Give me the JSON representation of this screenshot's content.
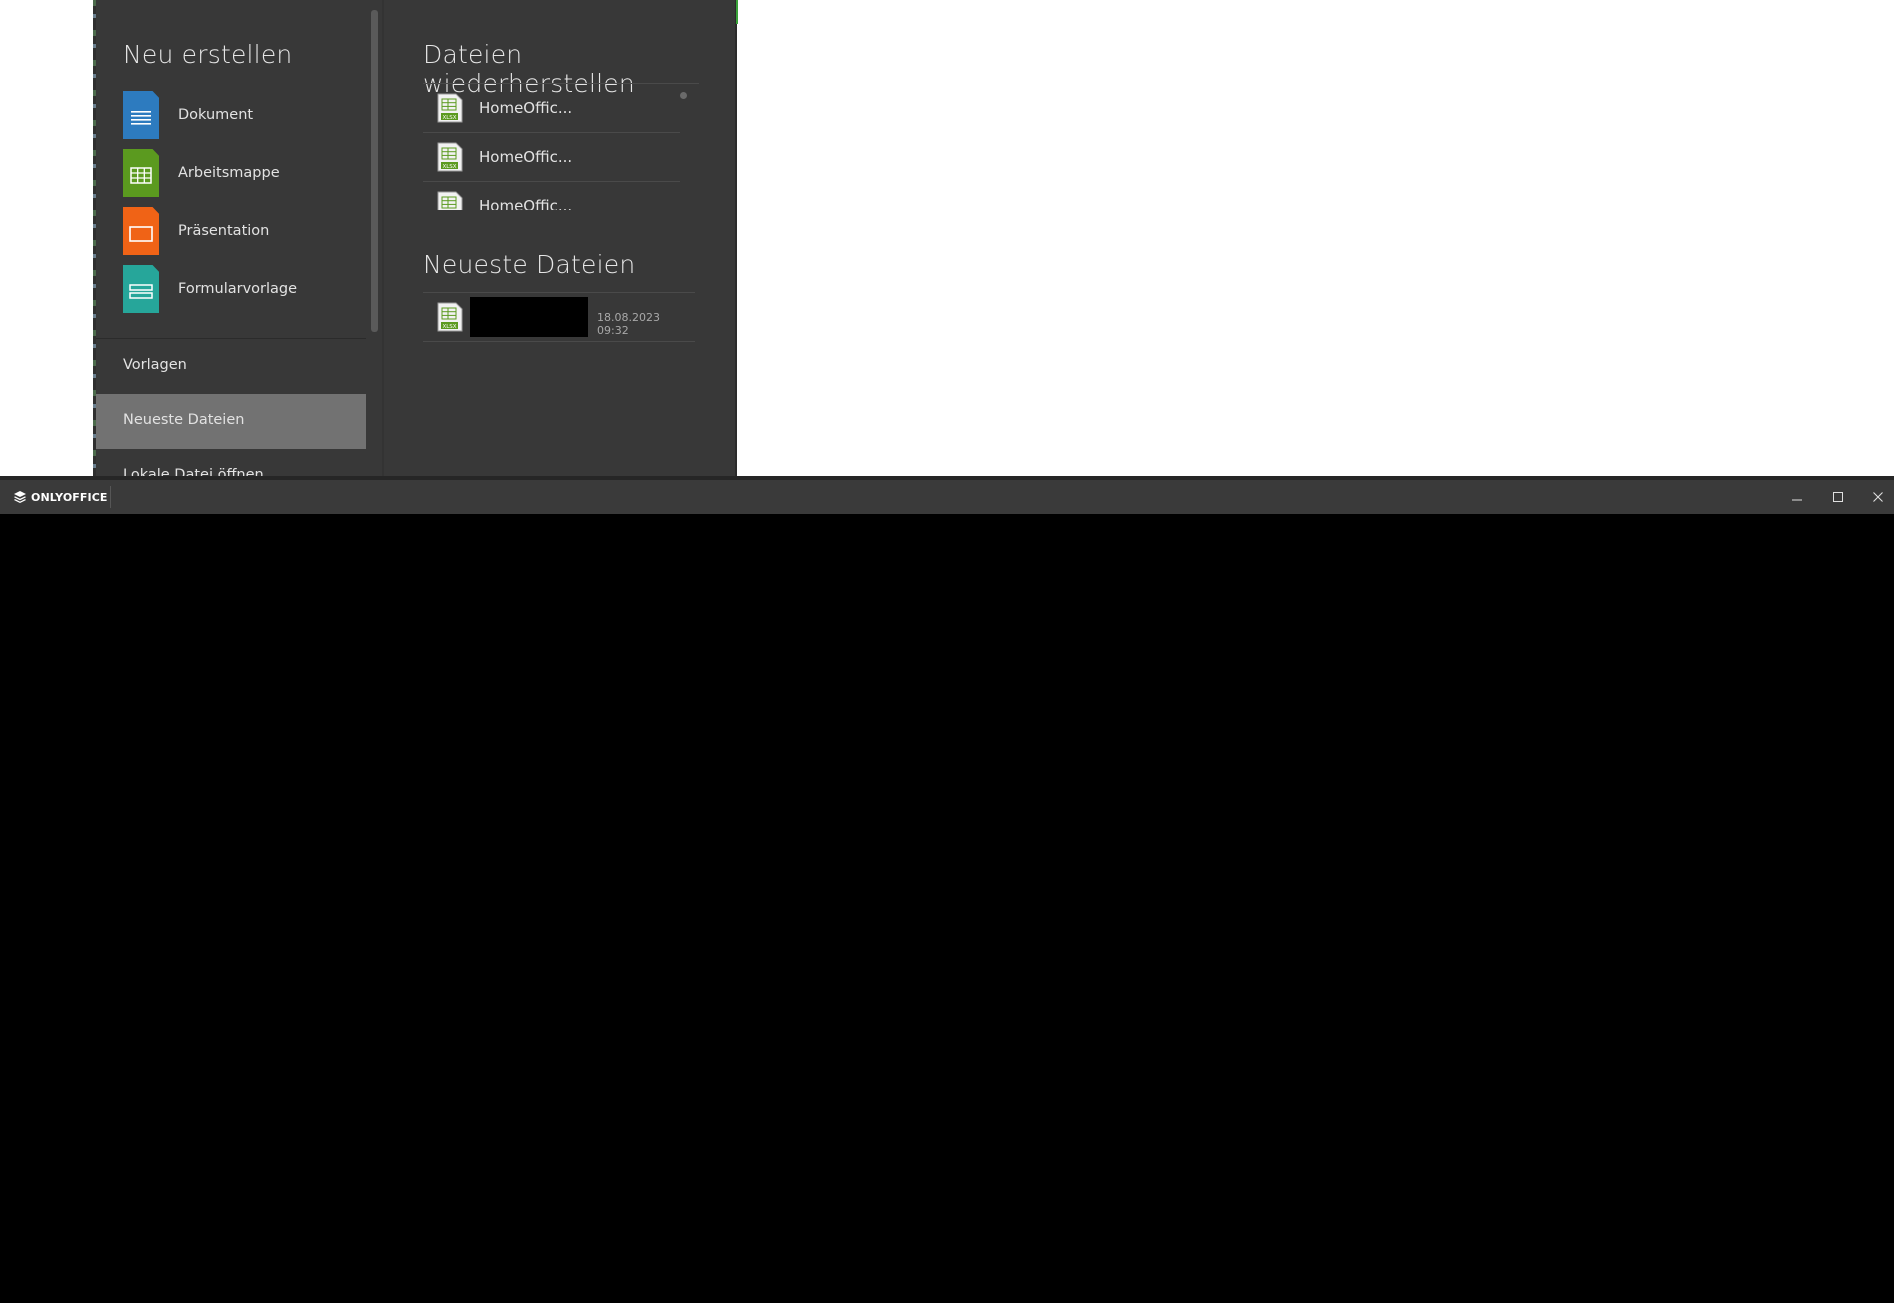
{
  "create_section": {
    "title": "Neu erstellen",
    "items": [
      {
        "label": "Dokument",
        "icon": "document-icon",
        "color": "#2d7bbf"
      },
      {
        "label": "Arbeitsmappe",
        "icon": "spreadsheet-icon",
        "color": "#5b9a1f"
      },
      {
        "label": "Präsentation",
        "icon": "presentation-icon",
        "color": "#f06316"
      },
      {
        "label": "Formularvorlage",
        "icon": "form-template-icon",
        "color": "#26a69a"
      }
    ]
  },
  "nav": {
    "templates": "Vorlagen",
    "recent": "Neueste Dateien",
    "open_local": "Lokale Datei öffnen"
  },
  "recover_section": {
    "title": "Dateien wiederherstellen",
    "files": [
      {
        "name": "HomeOffic...",
        "type": "XLSX"
      },
      {
        "name": "HomeOffic...",
        "type": "XLSX"
      },
      {
        "name": "HomeOffic...",
        "type": "XLSX"
      }
    ]
  },
  "recent_section": {
    "title": "Neueste Dateien",
    "files": [
      {
        "type": "XLSX",
        "date": "18.08.2023 09:32"
      }
    ]
  },
  "lower_window": {
    "brand": "ONLYOFFICE",
    "controls": {
      "minimize": "minimize-icon",
      "maximize": "maximize-icon",
      "close": "close-icon"
    }
  },
  "colors": {
    "panel_bg": "#383838",
    "active_nav_bg": "#727272",
    "titlebar_bg": "#3a3a3a",
    "xlsx_green": "#5b9a1f"
  }
}
